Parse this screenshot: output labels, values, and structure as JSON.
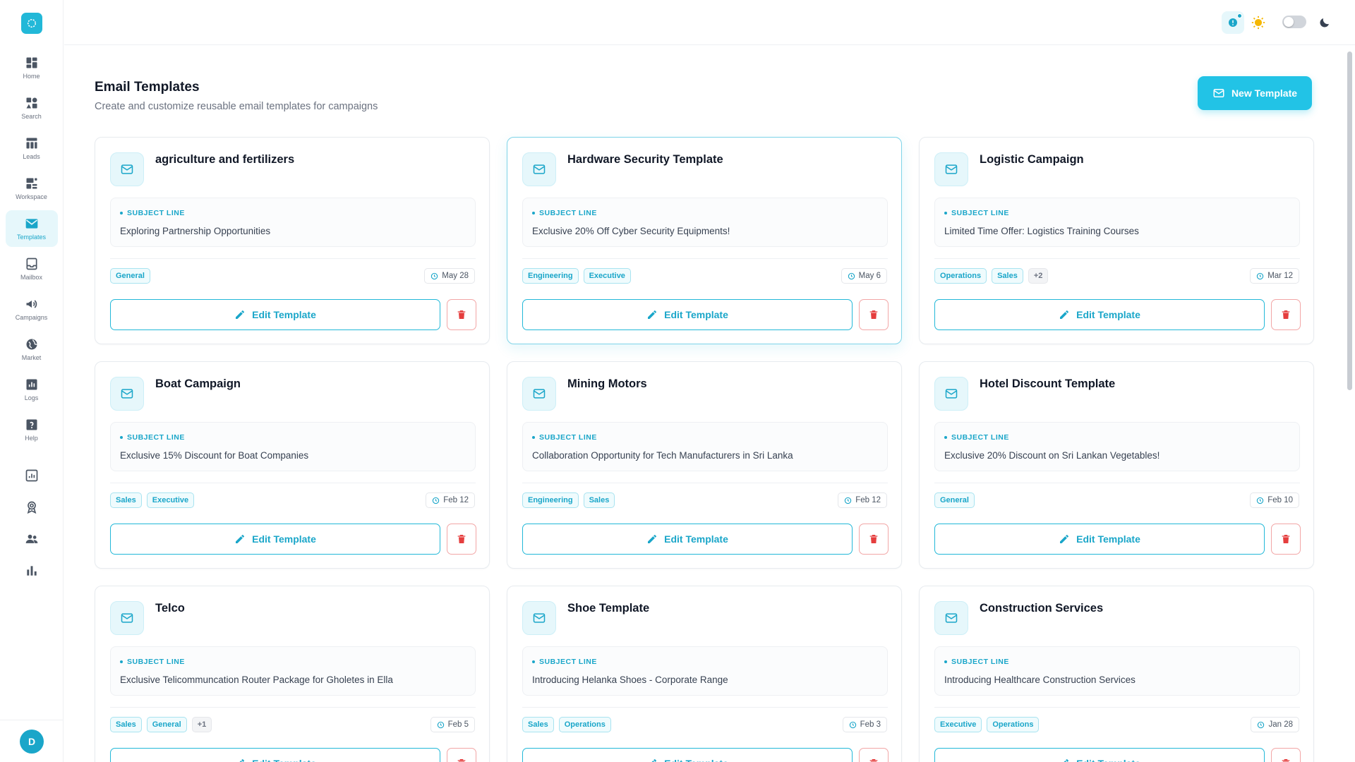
{
  "sidebar": {
    "logo_icon": "logo-icon",
    "items": [
      {
        "label": "Home",
        "icon": "home-icon"
      },
      {
        "label": "Search",
        "icon": "search-icon"
      },
      {
        "label": "Leads",
        "icon": "leads-icon"
      },
      {
        "label": "Workspace",
        "icon": "workspace-icon"
      },
      {
        "label": "Templates",
        "icon": "mail-icon",
        "active": true
      },
      {
        "label": "Mailbox",
        "icon": "mailbox-icon"
      },
      {
        "label": "Campaigns",
        "icon": "megaphone-icon"
      },
      {
        "label": "Market",
        "icon": "globe-icon"
      },
      {
        "label": "Logs",
        "icon": "logs-icon"
      },
      {
        "label": "Help",
        "icon": "help-icon"
      }
    ],
    "extra_icons": [
      "analytics-icon",
      "award-icon",
      "users-icon",
      "bar-chart-icon"
    ],
    "avatar_initial": "D"
  },
  "topbar": {
    "icons": [
      "notification-icon",
      "sun-icon",
      "theme-toggle",
      "moon-icon"
    ]
  },
  "page": {
    "title": "Email Templates",
    "subtitle": "Create and customize reusable email templates for campaigns",
    "new_button_label": "New Template"
  },
  "card_labels": {
    "subject_label": "SUBJECT LINE",
    "edit_label": "Edit Template"
  },
  "templates": [
    {
      "title": "agriculture and fertilizers",
      "subject": "Exploring Partnership Opportunities",
      "tags": [
        "General"
      ],
      "date": "May 28"
    },
    {
      "title": "Hardware Security Template",
      "subject": "Exclusive 20% Off Cyber Security Equipments!",
      "tags": [
        "Engineering",
        "Executive"
      ],
      "date": "May 6",
      "highlight": true
    },
    {
      "title": "Logistic Campaign",
      "subject": "Limited Time Offer: Logistics Training Courses",
      "tags": [
        "Operations",
        "Sales"
      ],
      "more": "+2",
      "date": "Mar 12"
    },
    {
      "title": "Boat Campaign",
      "subject": "Exclusive 15% Discount for Boat Companies",
      "tags": [
        "Sales",
        "Executive"
      ],
      "date": "Feb 12"
    },
    {
      "title": "Mining Motors",
      "subject": "Collaboration Opportunity for Tech Manufacturers in Sri Lanka",
      "tags": [
        "Engineering",
        "Sales"
      ],
      "date": "Feb 12"
    },
    {
      "title": "Hotel Discount Template",
      "subject": "Exclusive 20% Discount on Sri Lankan Vegetables!",
      "tags": [
        "General"
      ],
      "date": "Feb 10"
    },
    {
      "title": "Telco",
      "subject": "Exclusive Telicommuncation Router Package for Gholetes in Ella",
      "tags": [
        "Sales",
        "General"
      ],
      "more": "+1",
      "date": "Feb 5"
    },
    {
      "title": "Shoe Template",
      "subject": "Introducing Helanka Shoes - Corporate Range",
      "tags": [
        "Sales",
        "Operations"
      ],
      "date": "Feb 3"
    },
    {
      "title": "Construction Services",
      "subject": "Introducing Healthcare Construction Services",
      "tags": [
        "Executive",
        "Operations"
      ],
      "date": "Jan 28"
    }
  ],
  "colors": {
    "accent": "#22b8d8",
    "accent_dark": "#1aa6c9",
    "danger": "#e53e3e"
  }
}
